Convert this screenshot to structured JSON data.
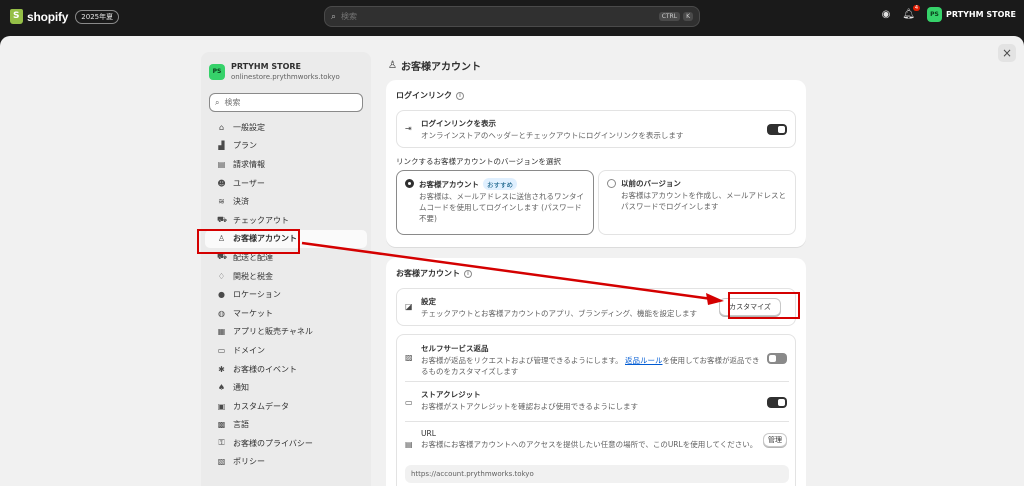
{
  "topbar": {
    "brand": "shopify",
    "edition": "2025年夏",
    "search_placeholder": "検索",
    "kbd_ctrl": "CTRL",
    "kbd_k": "K",
    "notification_count": "4",
    "store_initials": "PS",
    "store_name": "PRTYHM STORE"
  },
  "sidebar": {
    "store_initials": "PS",
    "store_name": "PRTYHM STORE",
    "store_domain": "onlinestore.prythmworks.tokyo",
    "search_placeholder": "検索",
    "items": [
      {
        "label": "一般設定",
        "icon": "store-icon"
      },
      {
        "label": "プラン",
        "icon": "chart-icon"
      },
      {
        "label": "請求情報",
        "icon": "receipt-icon"
      },
      {
        "label": "ユーザー",
        "icon": "users-icon"
      },
      {
        "label": "決済",
        "icon": "payment-icon"
      },
      {
        "label": "チェックアウト",
        "icon": "cart-icon"
      },
      {
        "label": "お客様アカウント",
        "icon": "person-icon"
      },
      {
        "label": "配送と配達",
        "icon": "truck-icon"
      },
      {
        "label": "関税と税金",
        "icon": "money-bag-icon"
      },
      {
        "label": "ロケーション",
        "icon": "pin-icon"
      },
      {
        "label": "マーケット",
        "icon": "globe-icon"
      },
      {
        "label": "アプリと販売チャネル",
        "icon": "apps-icon"
      },
      {
        "label": "ドメイン",
        "icon": "domain-icon"
      },
      {
        "label": "お客様のイベント",
        "icon": "events-icon"
      },
      {
        "label": "通知",
        "icon": "bell-icon"
      },
      {
        "label": "カスタムデータ",
        "icon": "database-icon"
      },
      {
        "label": "言語",
        "icon": "language-icon"
      },
      {
        "label": "お客様のプライバシー",
        "icon": "lock-icon"
      },
      {
        "label": "ポリシー",
        "icon": "policy-icon"
      }
    ]
  },
  "main": {
    "title": "お客様アカウント",
    "login_card": {
      "title": "ログインリンク",
      "show_title": "ログインリンクを表示",
      "show_desc": "オンラインストアのヘッダーとチェックアウトにログインリンクを表示します",
      "version_label": "リンクするお客様アカウントのバージョンを選択",
      "option_new_title": "お客様アカウント",
      "option_new_badge": "おすすめ",
      "option_new_desc": "お客様は、メールアドレスに送信されるワンタイムコードを使用してログインします (パスワード不要)",
      "option_old_title": "以前のバージョン",
      "option_old_desc": "お客様はアカウントを作成し、メールアドレスとパスワードでログインします"
    },
    "account_card": {
      "title": "お客様アカウント",
      "settings_title": "設定",
      "settings_desc": "チェックアウトとお客様アカウントのアプリ、ブランディング、機能を設定します",
      "customize_label": "カスタマイズ",
      "self_return_title": "セルフサービス返品",
      "self_return_desc_1": "お客様が返品をリクエストおよび管理できるようにします。",
      "self_return_link": "返品ルール",
      "self_return_desc_2": "を使用してお客様が返品できるものをカスタマイズします",
      "store_credit_title": "ストアクレジット",
      "store_credit_desc": "お客様がストアクレジットを確認および使用できるようにします",
      "url_title": "URL",
      "url_desc": "お客様にお客様アカウントへのアクセスを提供したい任意の場所で、このURLを使用してください。",
      "manage_label": "管理",
      "url_value": "https://account.prythmworks.tokyo"
    }
  },
  "annotation_color": "#d40000"
}
